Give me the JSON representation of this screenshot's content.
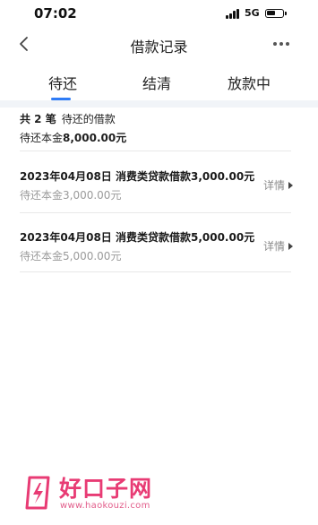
{
  "status_bar": {
    "time": "07:02",
    "network": "5G"
  },
  "nav": {
    "title": "借款记录"
  },
  "tabs": [
    {
      "label": "待还",
      "active": true
    },
    {
      "label": "结清",
      "active": false
    },
    {
      "label": "放款中",
      "active": false
    }
  ],
  "summary": {
    "count_text": "共 2 笔",
    "count_suffix": "待还的借款",
    "principal_label": "待还本金",
    "principal_value": "8,000.00元"
  },
  "loans": [
    {
      "title": "2023年04月08日 消费类贷款借款3,000.00元",
      "subtitle": "待还本金3,000.00元",
      "detail_label": "详情"
    },
    {
      "title": "2023年04月08日 消费类贷款借款5,000.00元",
      "subtitle": "待还本金5,000.00元",
      "detail_label": "详情"
    }
  ],
  "watermark": {
    "brand": "好口子网",
    "url": "www.haokouzi.com"
  },
  "colors": {
    "accent": "#2f7cf6",
    "watermark": "#e83b74"
  }
}
